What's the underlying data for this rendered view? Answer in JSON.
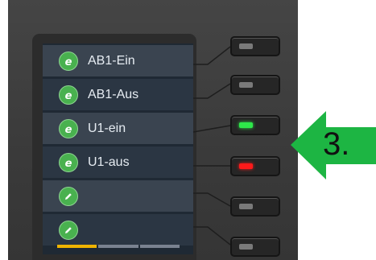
{
  "keys": [
    {
      "label": "AB1-Ein",
      "icon": "e-icon"
    },
    {
      "label": "AB1-Aus",
      "icon": "e-icon"
    },
    {
      "label": "U1-ein",
      "icon": "e-icon"
    },
    {
      "label": "U1-aus",
      "icon": "e-icon"
    },
    {
      "label": "",
      "icon": "pencil-icon"
    },
    {
      "label": "",
      "icon": "pencil-icon"
    }
  ],
  "leds": [
    "off",
    "off",
    "green",
    "red",
    "off",
    "off"
  ],
  "step_label": "3.",
  "colors": {
    "accent_green": "#49b14f",
    "arrow_green": "#1db543",
    "led_green": "#2ee84a",
    "led_red": "#ff1a1a",
    "tab_active": "#f0b400"
  }
}
